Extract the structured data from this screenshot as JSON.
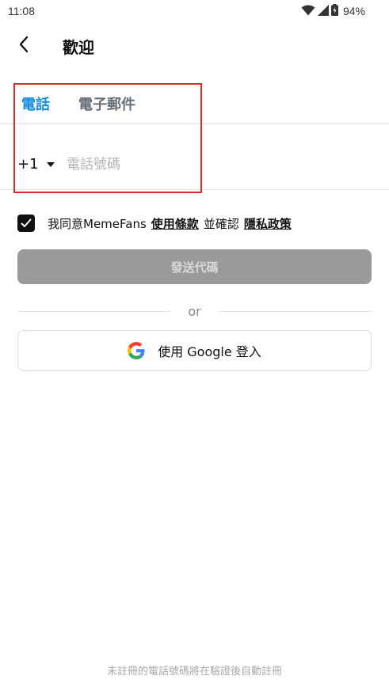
{
  "status_bar": {
    "time": "11:08",
    "battery": "94%",
    "icons": [
      "wifi-icon",
      "signal-icon",
      "battery-icon"
    ]
  },
  "header": {
    "back_icon": "chevron-left-icon",
    "title": "歡迎"
  },
  "tabs": [
    {
      "label": "電話",
      "active": true
    },
    {
      "label": "電子郵件",
      "active": false
    }
  ],
  "phone": {
    "country_code": "+1",
    "value": "",
    "placeholder": "電話號碼"
  },
  "agreement": {
    "checked": true,
    "prefix": "我同意MemeFans",
    "terms_link": "使用條款",
    "middle": "並確認",
    "privacy_link": "隱私政策"
  },
  "send_button": {
    "label": "發送代碼",
    "enabled": false
  },
  "divider": {
    "label": "or"
  },
  "google_button": {
    "icon": "google-icon",
    "label": "使用 Google 登入"
  },
  "footer": {
    "note": "未註冊的電話號碼將在驗證後自動註冊"
  },
  "colors": {
    "accent": "#1a8fe0",
    "highlight": "#e02b2b",
    "disabled_button": "#9a9a9a"
  }
}
